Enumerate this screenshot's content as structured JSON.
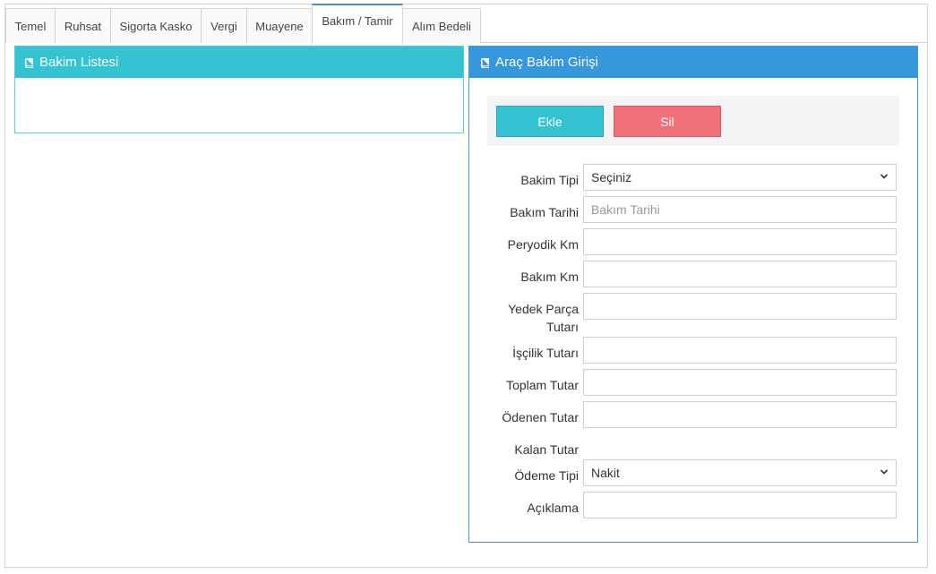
{
  "tabs": [
    {
      "label": "Temel",
      "active": false
    },
    {
      "label": "Ruhsat",
      "active": false
    },
    {
      "label": "Sigorta Kasko",
      "active": false
    },
    {
      "label": "Vergi",
      "active": false
    },
    {
      "label": "Muayene",
      "active": false
    },
    {
      "label": "Bakım / Tamir",
      "active": true
    },
    {
      "label": "Alım Bedeli",
      "active": false
    }
  ],
  "list_panel": {
    "title": "Bakim Listesi"
  },
  "form_panel": {
    "title": "Araç Bakim Girişi",
    "add_label": "Ekle",
    "delete_label": "Sil",
    "fields": {
      "bakim_tipi": {
        "label": "Bakim Tipi",
        "value": "Seçiniz"
      },
      "bakim_tarihi": {
        "label": "Bakım Tarihi",
        "placeholder": "Bakım Tarihi"
      },
      "peryodik_km": {
        "label": "Peryodik Km",
        "value": ""
      },
      "bakim_km": {
        "label": "Bakım Km",
        "value": ""
      },
      "yedek_parca": {
        "label_line1": "Yedek Parça",
        "label_line2": "Tutarı",
        "value": ""
      },
      "iscilik": {
        "label": "İşçilik Tutarı",
        "value": ""
      },
      "toplam": {
        "label": "Toplam Tutar",
        "value": ""
      },
      "odenen": {
        "label": "Ödenen Tutar",
        "value": ""
      },
      "kalan": {
        "label": "Kalan Tutar"
      },
      "odeme_tipi": {
        "label": "Ödeme Tipi",
        "value": "Nakit"
      },
      "aciklama": {
        "label": "Açıklama",
        "value": ""
      }
    }
  },
  "colors": {
    "list_header": "#33c3d2",
    "form_header": "#3597dc",
    "add_button": "#33c3d2",
    "delete_button": "#f0707a"
  },
  "icons": {
    "panel": "book-icon",
    "select": "chevron-down-icon"
  }
}
